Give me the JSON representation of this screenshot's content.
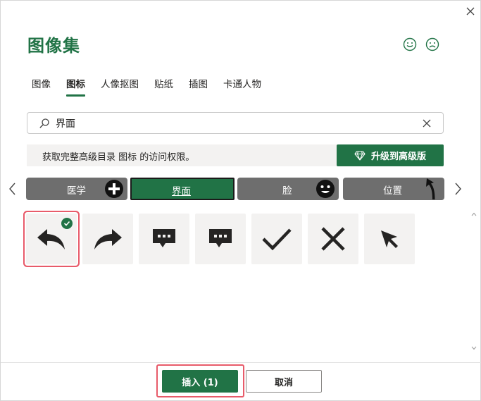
{
  "dialog": {
    "title": "图像集",
    "close_icon": "close-icon",
    "feedback": {
      "happy_icon": "smiley-icon",
      "sad_icon": "frown-icon"
    }
  },
  "tabs": [
    {
      "label": "图像",
      "active": false
    },
    {
      "label": "图标",
      "active": true
    },
    {
      "label": "人像抠图",
      "active": false
    },
    {
      "label": "贴纸",
      "active": false
    },
    {
      "label": "插图",
      "active": false
    },
    {
      "label": "卡通人物",
      "active": false
    }
  ],
  "search": {
    "value": "界面",
    "icon": "search-icon",
    "clear_icon": "clear-icon"
  },
  "upgrade": {
    "message": "获取完整高级目录 图标 的访问权限。",
    "button_label": "升级到高级版",
    "button_icon": "diamond-icon"
  },
  "categories": [
    {
      "label": "医学",
      "icon": "plus-circle-icon",
      "active": false
    },
    {
      "label": "界面",
      "active": true
    },
    {
      "label": "脸",
      "icon": "face-icon",
      "active": false
    },
    {
      "label": "位置",
      "icon": "curved-arrow-icon",
      "active": false
    }
  ],
  "icons": [
    {
      "name": "reply-arrow-icon",
      "selected": true
    },
    {
      "name": "forward-arrow-icon",
      "selected": false
    },
    {
      "name": "speech-bubble-dots-icon",
      "selected": false
    },
    {
      "name": "speech-bubble-dots-icon",
      "selected": false
    },
    {
      "name": "checkmark-icon",
      "selected": false
    },
    {
      "name": "x-mark-icon",
      "selected": false
    },
    {
      "name": "cursor-arrow-icon",
      "selected": false
    }
  ],
  "footer": {
    "insert_label": "插入 (1)",
    "cancel_label": "取消"
  },
  "colors": {
    "accent": "#217346",
    "category_bg": "#6e6e6e",
    "selection": "#e85b6a",
    "tile_bg": "#f3f2f1",
    "icon": "#252423"
  }
}
